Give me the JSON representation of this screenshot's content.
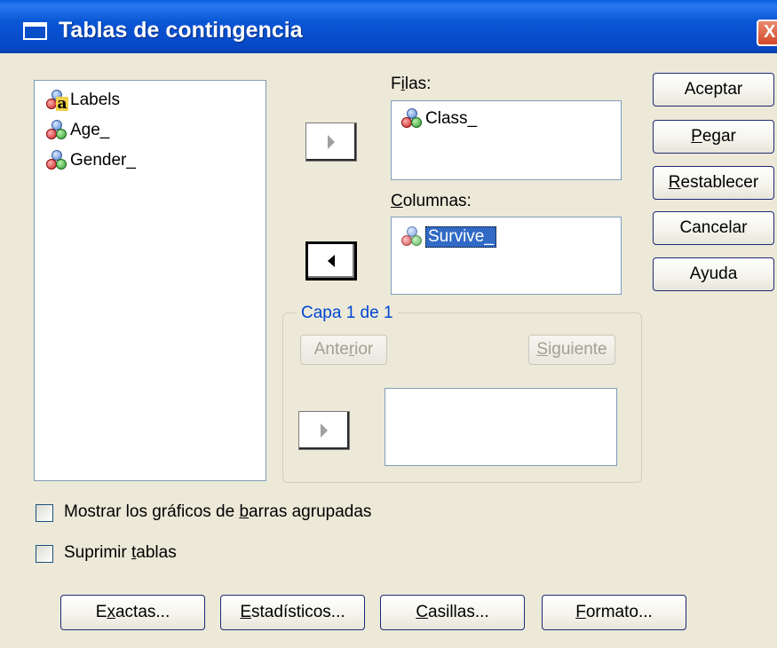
{
  "window": {
    "title": "Tablas de contingencia",
    "close_label": "X"
  },
  "variable_list": {
    "items": [
      {
        "label": "Labels",
        "icon": "string-variable-icon"
      },
      {
        "label": "Age_",
        "icon": "nominal-variable-icon"
      },
      {
        "label": "Gender_",
        "icon": "nominal-variable-icon"
      }
    ]
  },
  "rows": {
    "label_prefix": "F",
    "label_underlined": "i",
    "label_suffix": "las:",
    "items": [
      {
        "label": "Class_",
        "icon": "nominal-variable-icon"
      }
    ]
  },
  "columns": {
    "label_prefix": "",
    "label_underlined": "C",
    "label_suffix": "olumnas:",
    "items": [
      {
        "label": "Survive_",
        "icon": "nominal-variable-icon",
        "selected": true
      }
    ]
  },
  "layer": {
    "legend": "Capa 1 de 1",
    "prev_prefix": "Ante",
    "prev_underlined": "r",
    "prev_suffix": "ior",
    "next_prefix": "",
    "next_underlined": "S",
    "next_suffix": "iguiente"
  },
  "side_buttons": {
    "accept": {
      "prefix": "Aceptar",
      "underlined": "",
      "suffix": ""
    },
    "paste": {
      "prefix": "",
      "underlined": "P",
      "suffix": "egar"
    },
    "reset": {
      "prefix": "",
      "underlined": "R",
      "suffix": "establecer"
    },
    "cancel": {
      "prefix": "Cancelar",
      "underlined": "",
      "suffix": ""
    },
    "help": {
      "prefix": "Ayuda",
      "underlined": "",
      "suffix": ""
    }
  },
  "checkboxes": {
    "clustered_bars": {
      "prefix": "Mostrar los gráficos de ",
      "underlined": "b",
      "suffix": "arras agrupadas",
      "checked": false
    },
    "suppress_tables": {
      "prefix": "Suprimir ",
      "underlined": "t",
      "suffix": "ablas",
      "checked": false
    }
  },
  "bottom_buttons": {
    "exact": {
      "prefix": "E",
      "underlined": "x",
      "suffix": "actas..."
    },
    "statistics": {
      "prefix": "",
      "underlined": "E",
      "suffix": "stadísticos..."
    },
    "cells": {
      "prefix": "",
      "underlined": "C",
      "suffix": "asillas..."
    },
    "format": {
      "prefix": "",
      "underlined": "F",
      "suffix": "ormato..."
    }
  },
  "colors": {
    "titlebar": "#0a57d6",
    "dialog_bg": "#ece9d8",
    "selection": "#316ac5",
    "group_legend": "#0046d5"
  }
}
